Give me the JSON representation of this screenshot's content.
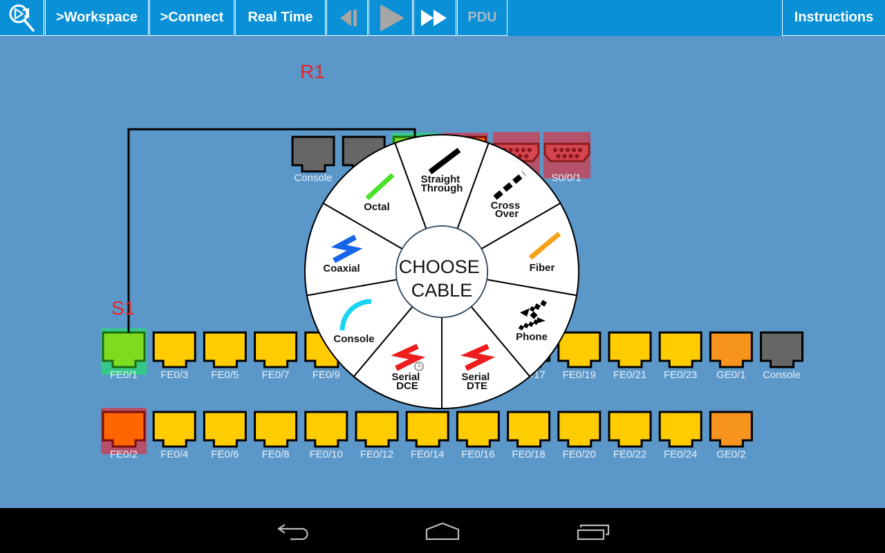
{
  "toolbar": {
    "app_button_icon": "magnifier-play-icon",
    "workspace_label": ">Workspace",
    "connect_label": ">Connect",
    "realtime_label": "Real Time",
    "step_back_icon": "step-back-icon",
    "play_icon": "play-icon",
    "fast_forward_icon": "fast-forward-icon",
    "pdu_label": "PDU",
    "instructions_label": "Instructions",
    "disabled_controls": [
      "step-back",
      "play",
      "pdu"
    ]
  },
  "colors": {
    "toolbar_bg": "#0a90d6",
    "workspace_bg": "#5b97c9",
    "device_label": "#e3262b",
    "port_label": "#e6eff8",
    "disabled_icon": "#a6a6a6",
    "cable": "#000000",
    "nav_icon": "#bbbbbb"
  },
  "port_types": {
    "fastethernet": {
      "fill": "#ffcc00",
      "stroke": "#000000"
    },
    "gigabit": {
      "fill": "#f7941d",
      "stroke": "#000000"
    },
    "console": {
      "fill": "#666666",
      "stroke": "#000000"
    },
    "serial": {
      "fill": "#d64550",
      "stroke": "#8b1a1a"
    }
  },
  "port_states": {
    "connected": {
      "fill": "#7ddc1f",
      "stroke": "#1d6b12",
      "highlight": "#36c98a"
    },
    "selected": {
      "fill": "#ff6600",
      "stroke": "#7a0c0c",
      "highlight": "#b5526b"
    },
    "flagged": {
      "highlight": "#b5526b"
    }
  },
  "router": {
    "label": "R1",
    "ports": [
      {
        "label": "Console",
        "type": "console"
      },
      {
        "label": null,
        "type": "console"
      },
      {
        "label": null,
        "type": "fastethernet",
        "state": "connected"
      },
      {
        "label": null,
        "type": "gigabit",
        "state": "selected"
      },
      {
        "label": null,
        "type": "serial",
        "state": "flagged"
      },
      {
        "label": "S0/0/1",
        "type": "serial",
        "state": "flagged"
      }
    ]
  },
  "switch": {
    "label": "S1",
    "rows": [
      [
        {
          "label": "FE0/1",
          "type": "fastethernet",
          "state": "connected"
        },
        {
          "label": "FE0/3",
          "type": "fastethernet"
        },
        {
          "label": "FE0/5",
          "type": "fastethernet"
        },
        {
          "label": "FE0/7",
          "type": "fastethernet"
        },
        {
          "label": "FE0/9",
          "type": "fastethernet"
        },
        {
          "label": null,
          "type": "fastethernet"
        },
        {
          "label": null,
          "type": "fastethernet"
        },
        {
          "label": null,
          "type": "fastethernet"
        },
        {
          "label": "FE0/17",
          "type": "fastethernet"
        },
        {
          "label": "FE0/19",
          "type": "fastethernet"
        },
        {
          "label": "FE0/21",
          "type": "fastethernet"
        },
        {
          "label": "FE0/23",
          "type": "fastethernet"
        },
        {
          "label": "GE0/1",
          "type": "gigabit"
        },
        {
          "label": "Console",
          "type": "console"
        }
      ],
      [
        {
          "label": "FE0/2",
          "type": "fastethernet",
          "state": "selected"
        },
        {
          "label": "FE0/4",
          "type": "fastethernet"
        },
        {
          "label": "FE0/6",
          "type": "fastethernet"
        },
        {
          "label": "FE0/8",
          "type": "fastethernet"
        },
        {
          "label": "FE0/10",
          "type": "fastethernet"
        },
        {
          "label": "FE0/12",
          "type": "fastethernet"
        },
        {
          "label": "FE0/14",
          "type": "fastethernet"
        },
        {
          "label": "FE0/16",
          "type": "fastethernet"
        },
        {
          "label": "FE0/18",
          "type": "fastethernet"
        },
        {
          "label": "FE0/20",
          "type": "fastethernet"
        },
        {
          "label": "FE0/22",
          "type": "fastethernet"
        },
        {
          "label": "FE0/24",
          "type": "fastethernet"
        },
        {
          "label": "GE0/2",
          "type": "gigabit"
        }
      ]
    ]
  },
  "link": {
    "from": {
      "device": "S1",
      "port": "FE0/1"
    },
    "to": {
      "device": "R1",
      "port_index": 2
    },
    "color": "#000000"
  },
  "cable_menu": {
    "title_lines": [
      "CHOOSE",
      "CABLE"
    ],
    "options": [
      {
        "id": "straight-through",
        "label_lines": [
          "Straight",
          "Through"
        ],
        "icon": "straight-cable-icon",
        "color": "#000000"
      },
      {
        "id": "cross-over",
        "label_lines": [
          "Cross",
          "Over"
        ],
        "icon": "crossover-cable-icon",
        "color": "#000000"
      },
      {
        "id": "fiber",
        "label_lines": [
          "Fiber"
        ],
        "icon": "fiber-cable-icon",
        "color": "#f7a11a"
      },
      {
        "id": "phone",
        "label_lines": [
          "Phone"
        ],
        "icon": "phone-cable-icon",
        "color": "#000000"
      },
      {
        "id": "serial-dte",
        "label_lines": [
          "Serial",
          "DTE"
        ],
        "icon": "serial-dte-cable-icon",
        "color": "#ee1c1c"
      },
      {
        "id": "serial-dce",
        "label_lines": [
          "Serial",
          "DCE"
        ],
        "icon": "serial-dce-cable-icon",
        "color": "#ee1c1c"
      },
      {
        "id": "console",
        "label_lines": [
          "Console"
        ],
        "icon": "console-cable-icon",
        "color": "#19d3f3"
      },
      {
        "id": "coaxial",
        "label_lines": [
          "Coaxial"
        ],
        "icon": "coaxial-cable-icon",
        "color": "#1565e8"
      },
      {
        "id": "octal",
        "label_lines": [
          "Octal"
        ],
        "icon": "octal-cable-icon",
        "color": "#4be02a"
      }
    ]
  },
  "system_nav": {
    "back_icon": "back-icon",
    "home_icon": "home-icon",
    "recents_icon": "recents-icon"
  }
}
